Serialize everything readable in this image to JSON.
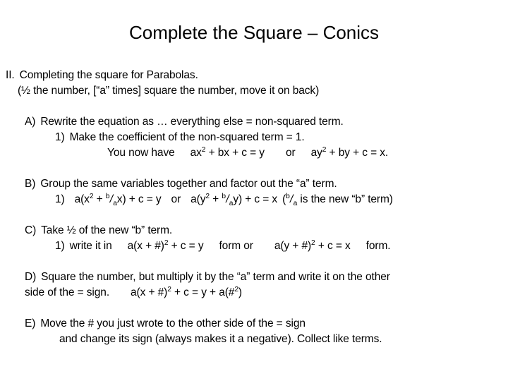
{
  "slide": {
    "title": "Complete the Square – Conics",
    "background_color": "#ffffff",
    "text_color": "#000000"
  },
  "content": {
    "section_number": "II.",
    "section_heading": "Completing the square for Parabolas.",
    "section_subnote": "(½ the number, [“a” times] square the number, move it on back)",
    "items": [
      {
        "label": "A)",
        "text": "Rewrite the equation as … everything else = non-squared term.",
        "sub_label": "1)",
        "sub_text": "Make the coefficient of the non-squared term = 1.",
        "equation_lead": "You now have",
        "equation_1_pre": "ax",
        "equation_1_exp": "2",
        "equation_1_post": " + bx + c = y",
        "equation_connector": "or",
        "equation_2_pre": "ay",
        "equation_2_exp": "2",
        "equation_2_post": " + by + c = x."
      },
      {
        "label": "B)",
        "text": "Group the same variables together and factor out the “a” term.",
        "sub_label": "1)",
        "eq_left_a": "a(x",
        "eq_left_exp": "2",
        "eq_left_plus": " + ",
        "frac_num": "b",
        "frac_slash": "/",
        "frac_den": "a",
        "eq_left_tail": "x) + c = y",
        "eq_connector": "or",
        "eq_right_a": "a(y",
        "eq_right_exp": "2",
        "eq_right_plus": " + ",
        "eq_right_tail": "y) + c = x",
        "note_open": "(",
        "note_text": " is the new “b” term)"
      },
      {
        "label": "C)",
        "text": "Take ½ of the new “b” term.",
        "sub_label": "1)",
        "sub_text": "write it in",
        "eq_left_pre": "a(x + #)",
        "eq_left_exp": "2",
        "eq_left_post": " + c  = y",
        "form_connector": "form or",
        "eq_right_pre": "a(y + #)",
        "eq_right_exp": "2",
        "eq_right_post": " + c = x",
        "form_trailer": "form."
      },
      {
        "label": "D)",
        "text_line1": "Square the number, but multiply it by the “a” term and write it on the other",
        "text_line2": "side of the = sign.",
        "eq_pre": "a(x + #)",
        "eq_exp": "2",
        "eq_mid": " + c = y + a(#",
        "eq_exp2": "2",
        "eq_post": ")"
      },
      {
        "label": "E)",
        "text_line1": "Move the # you just wrote to the other side of the = sign",
        "text_line2": "and change its sign (always makes it a negative). Collect like terms."
      }
    ]
  }
}
